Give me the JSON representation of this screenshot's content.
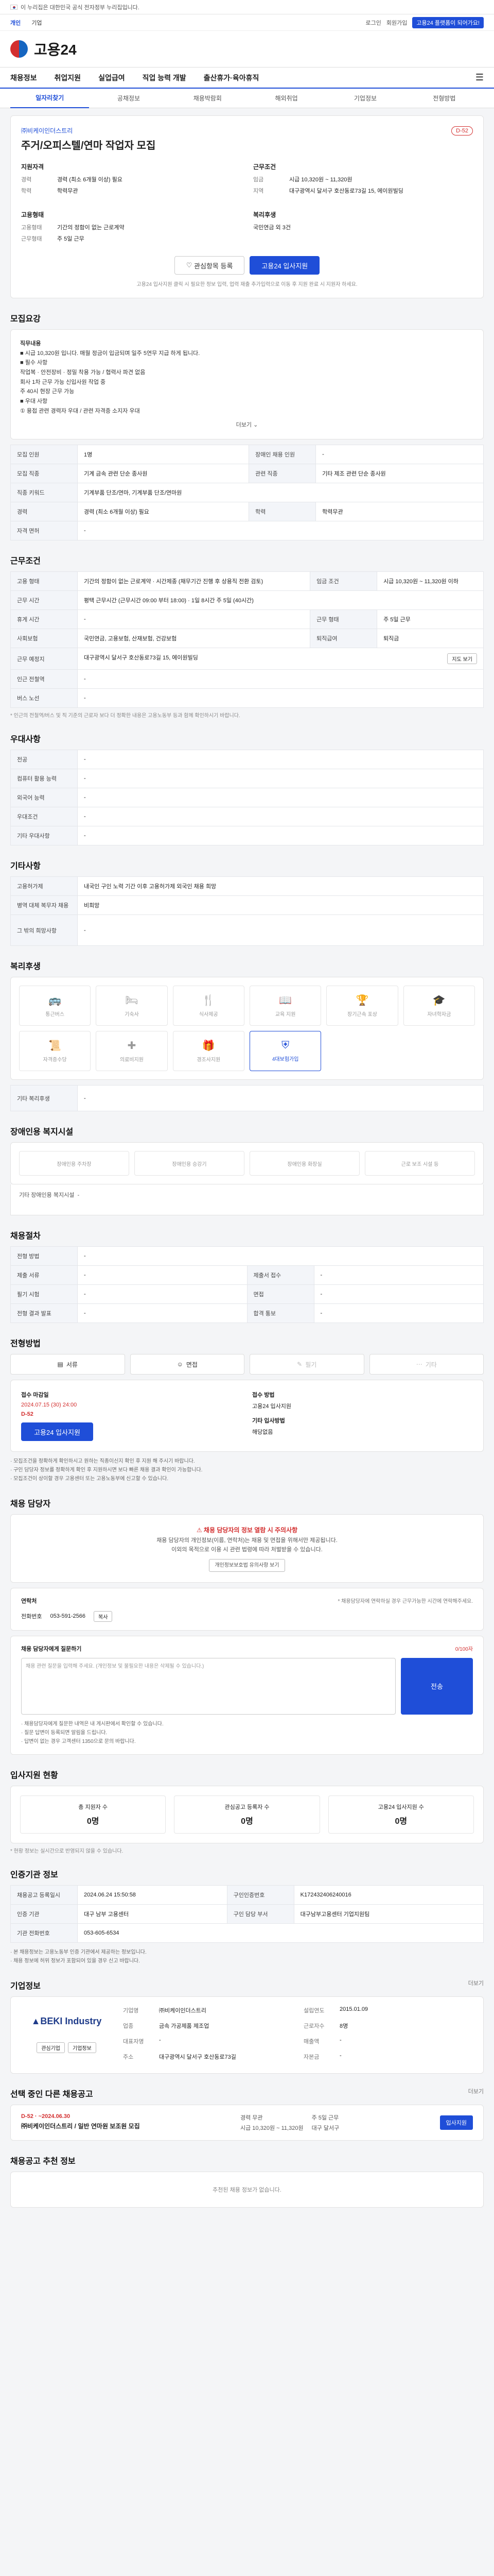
{
  "gov_bar": {
    "text": "이 누리집은 대한민국 공식 전자정부 누리집입니다."
  },
  "top_links": {
    "items": [
      "개인",
      "기업"
    ],
    "right": [
      "로그인",
      "회원가입",
      "고용24 플랫폼이 되어가요!"
    ]
  },
  "logo": {
    "text": "고용24"
  },
  "gnb": {
    "items": [
      "채용정보",
      "취업지원",
      "실업급여",
      "직업 능력 개발",
      "출산휴가·육아휴직"
    ]
  },
  "lnb": {
    "items": [
      "일자리찾기",
      "공채정보",
      "채용박람회",
      "해외취업",
      "기업정보",
      "전형방법"
    ]
  },
  "job": {
    "company": "㈜비케이인더스트리",
    "title": "주거/오피스텔/연마 작업자 모집",
    "dday": "D-52",
    "blocks": {
      "left_title": "지원자격",
      "left_kv": [
        {
          "k": "경력",
          "v": "경력 (최소 6개월 이상) 필요"
        },
        {
          "k": "학력",
          "v": "학력무관"
        }
      ],
      "right_title": "근무조건",
      "right_kv": [
        {
          "k": "임금",
          "v": "시급 10,320원 ~ 11,320원"
        },
        {
          "k": "지역",
          "v": "대구광역시 달서구 호산동로73길 15, 에이원빌딩"
        }
      ],
      "left2_title": "고용형태",
      "left2_kv": [
        {
          "k": "고용형태",
          "v": "기간의 정함이 없는 근로계약"
        },
        {
          "k": "근무형태",
          "v": "주 5일 근무"
        }
      ],
      "right2_title": "복리후생",
      "right2_kv": [
        {
          "k": "",
          "v": "국민연금 외 3건"
        }
      ]
    },
    "buttons": {
      "interest": "관심항목 등록",
      "apply": "고용24 입사지원"
    },
    "note": "고용24 입사지원 클릭 시 필요한 정보 입력, 업력 재출 추가입력으로 이동 후 지원 완료 시 지원자 하세요."
  },
  "recruit": {
    "section_title": "모집요강",
    "desc_lines": [
      "직무내용",
      "■ 시급 10,320원 입니다. 매월 정금이 입금되며 일주 5연무 지급 하게 됩니다.",
      "■ 필수 사항",
      "작업복 · 안전장비 · 정밀 착용 가능 / 협력사 파견 없음",
      "회사 1차 근무 가능 신입사원 작업 중",
      "주 40시 현장 근무 가능",
      "■ 우대 사항",
      "① 용접 관련 경력자 우대 / 관련 자격증 소지자 우대"
    ],
    "more": "더보기",
    "table": [
      {
        "k": "모집 인원",
        "v": "1명",
        "k2": "장애인 채용 인원",
        "v2": "-"
      },
      {
        "k": "모집 직종",
        "v": "기계 금속 관련 단순 종사원",
        "k2": "관련 직종",
        "v2": "기타 제조 관련 단순 종사원"
      },
      {
        "k": "직종 키워드",
        "v": "기계부품 단조/연마, 기계부품 단조/연마원",
        "k2": "",
        "v2": ""
      },
      {
        "k": "경력",
        "v": "경력 (최소 6개월 이상) 필요",
        "k2": "학력",
        "v2": "학력무관"
      },
      {
        "k": "자격 면허",
        "v": "-",
        "k2": "",
        "v2": ""
      }
    ]
  },
  "conditions": {
    "section_title": "근무조건",
    "table": [
      {
        "k": "고용 형태",
        "v": "기간의 정함이 없는 근로계약 · 시간제종 (채무기간 진행 후 상용직 전환 검토)",
        "k2": "임금 조건",
        "v2": "시급 10,320원 ~ 11,320원 이하"
      },
      {
        "k": "근무 시간",
        "v": "평택 근무시간 (근무시간 09:00 부터 18:00) · 1일 8시간 주 5일 (40시간)",
        "k2": "",
        "v2": ""
      },
      {
        "k": "휴게 시간",
        "v": "-",
        "k2": "근무 형태",
        "v2": "주 5일 근무"
      },
      {
        "k": "사회보험",
        "v": "국민연금, 고용보험, 산재보험, 건강보험",
        "k2": "퇴직급여",
        "v2": "퇴직금"
      },
      {
        "k": "근무 예정지",
        "v": "대구광역시 달서구 호산동로73길 15, 에이원빌딩",
        "k2": "",
        "v2": ""
      },
      {
        "k": "인근 전철역",
        "v": "-",
        "k2": "",
        "v2": ""
      },
      {
        "k": "버스 노선",
        "v": "-",
        "k2": "",
        "v2": ""
      }
    ],
    "map_btn": "지도 보기",
    "note": "* 인근의 전철역/버스 및 직 기준의 근로자 보다 더 정확한 내용은 고용노동부 등과 함께 확인하시기 바랍니다."
  },
  "preference": {
    "section_title": "우대사항",
    "table": [
      {
        "k": "전공",
        "v": "-"
      },
      {
        "k": "컴퓨터 활용 능력",
        "v": "-"
      },
      {
        "k": "외국어 능력",
        "v": "-"
      },
      {
        "k": "우대조건",
        "v": "-"
      },
      {
        "k": "기타 우대사항",
        "v": "-"
      }
    ]
  },
  "other": {
    "section_title": "기타사항",
    "table": [
      {
        "k": "고용허가제",
        "v": "내국인 구인 노력 기간 이후 고용허가제 외국인 채용 희망"
      },
      {
        "k": "병역 대체 복무자 채용",
        "v": "비희망"
      },
      {
        "k": "그 밖의 희망사항",
        "v": "-"
      }
    ]
  },
  "welfare": {
    "section_title": "복리후생",
    "items": [
      "통근버스",
      "기숙사",
      "식사제공",
      "교육 지원",
      "장기근속 포상",
      "자녀학자금",
      "자격증수당",
      "의료비지원",
      "경조사지원",
      "4대보험가입"
    ],
    "active_index": 9,
    "other_label": "기타 복리후생",
    "other_value": "-"
  },
  "disability": {
    "section_title": "장애인용 복지시설",
    "items": [
      "장애인용 주차장",
      "장애인용 승강기",
      "장애인용 화장실",
      "근로 보조 시설 등"
    ],
    "other_label": "기타 장애인용 복지시설",
    "other_value": "-"
  },
  "process": {
    "section_title": "채용절차",
    "table": [
      {
        "k": "전형 방법",
        "v": "-"
      },
      {
        "k": "제출 서류",
        "v": "-",
        "k2": "제출서 접수",
        "v2": "-"
      },
      {
        "k": "필기 시험",
        "v": "-",
        "k2": "면접",
        "v2": "-"
      },
      {
        "k": "전형 결과 발표",
        "v": "-",
        "k2": "합격 통보",
        "v2": "-"
      }
    ]
  },
  "methods": {
    "section_title": "전형방법",
    "items": [
      "서류",
      "면접",
      "필기",
      "기타"
    ]
  },
  "apply": {
    "period_label": "접수 마감일",
    "period_value": "2024.07.15 (30) 24:00",
    "dday": "D-52",
    "apply_btn": "고용24 입사지원",
    "method_label": "접수 방법",
    "method_value": "고용24 입사지원",
    "etc_label": "기타 입사방법",
    "etc_value": "해당없음",
    "notes": [
      "· 모집조건을 정확하게 확인하시고 원하는 직종이신지 확인 후 지원 해 주시기 바랍니다.",
      "· 구인 담당자 정보를 정확하게 확인 후 지원하시면 보다 빠른 채용 결과 확인이 가능합니다.",
      "· 모집조건이 상이할 경우 고용센터 또는 고용노동부에 신고할 수 있습니다."
    ]
  },
  "contact": {
    "section_title": "채용 담당자",
    "warn": "채용 담당자의 정보 열람 시 주의사항",
    "desc1": "채용 담당자의 개인정보(이름, 연락처)는 채용 및 면접을 위해서만 제공됩니다.",
    "desc2": "이외의 목적으로 이용 시 관련 법령에 따라 처벌받을 수 있습니다.",
    "check_btn": "개인정보보호법 유의사항 보기",
    "row_title": "연락처",
    "row_note": "* 채용담당자에 연락하실 경우 근무가능한 시간에 연락해주세요.",
    "phone_label": "전화번호",
    "phone": "053-591-2566",
    "copy_btn": "복사",
    "msg_title": "채용 담당자에게 질문하기",
    "msg_limit": "0/100자",
    "msg_placeholder": "채용 관련 질문을 입력해 주세요. (개인정보 및 불필요한 내용은 삭제될 수 있습니다.)",
    "msg_send": "전송",
    "msg_notes": [
      "· 채용담당자에게 질문한 내역은 내 게시판에서 확인할 수 있습니다.",
      "· 질문 답변이 등록되면 알림을 드립니다.",
      "· 답변이 없는 경우 고객센터 1350으로 문의 바랍니다."
    ]
  },
  "stats": {
    "section_title": "입사지원 현황",
    "items": [
      {
        "label": "총 지원자 수",
        "value": "0명"
      },
      {
        "label": "관심공고 등록자 수",
        "value": "0명"
      },
      {
        "label": "고용24 입사지원 수",
        "value": "0명"
      }
    ],
    "note": "* 현황 정보는 실시간으로 반영되지 않을 수 있습니다."
  },
  "info": {
    "section_title": "인증기관 정보",
    "table": [
      {
        "k": "채용공고 등록일시",
        "v": "2024.06.24 15:50:58",
        "k2": "구인인증번호",
        "v2": "K172432406240016"
      },
      {
        "k": "인증 기관",
        "v": "대구 남부 고용센터",
        "k2": "구인 담당 부서",
        "v2": "대구남부고용센터 기업지원팀"
      },
      {
        "k": "기관 전화번호",
        "v": "053-605-6534",
        "k2": "",
        "v2": ""
      }
    ],
    "notes": [
      "· 본 채용정보는 고용노동부 인증 기관에서 제공하는 정보입니다.",
      "· 채용 정보에 허위 정보가 포함되어 있을 경우 신고 바랍니다."
    ]
  },
  "company": {
    "section_title": "기업정보",
    "more": "더보기",
    "logo_text": "BEKI Industry",
    "btns": [
      "관심기업",
      "기업정보"
    ],
    "kv": [
      {
        "k": "기업명",
        "v": "㈜비케이인더스트리"
      },
      {
        "k": "업종",
        "v": "금속 가공제품 제조업"
      },
      {
        "k": "대표자명",
        "v": "-"
      },
      {
        "k": "주소",
        "v": "대구광역시 달서구 호산동로73길"
      },
      {
        "k": "설립연도",
        "v": "2015.01.09"
      },
      {
        "k": "근로자수",
        "v": "8명"
      },
      {
        "k": "매출액",
        "v": "-"
      },
      {
        "k": "자본금",
        "v": "-"
      }
    ]
  },
  "similar": {
    "section_title": "선택 중인 다른 채용공고",
    "more": "더보기",
    "dday": "D-52 · ~2024.06.30",
    "name": "㈜비케이인더스트리 / 일반 연마원 보조원 모집",
    "right": [
      "경력 무관",
      "주 5일 근무",
      "시급 10,320원 ~ 11,320원",
      "대구 달서구"
    ],
    "apply": "입사지원"
  },
  "recommend": {
    "section_title": "채용공고 추천 정보",
    "empty": "추천된 채용 정보가 없습니다."
  }
}
